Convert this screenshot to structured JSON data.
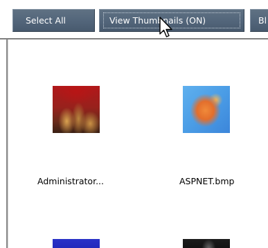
{
  "toolbar": {
    "select_all_label": "Select All",
    "view_thumbnails_label": "View Thumbnails (ON)",
    "partial_button_label": "Bl"
  },
  "files": [
    {
      "name": "Administrator...",
      "thumbnail": "red-brown-image-thumbnail"
    },
    {
      "name": "ASPNET.bmp",
      "thumbnail": "orange-fish-on-blue-thumbnail"
    },
    {
      "name": "",
      "thumbnail": "blue-image-thumbnail"
    },
    {
      "name": "",
      "thumbnail": "dark-image-thumbnail"
    }
  ],
  "colors": {
    "button_bg": "#52657a",
    "button_text": "#ffffff",
    "panel_bg": "#ffffff"
  }
}
